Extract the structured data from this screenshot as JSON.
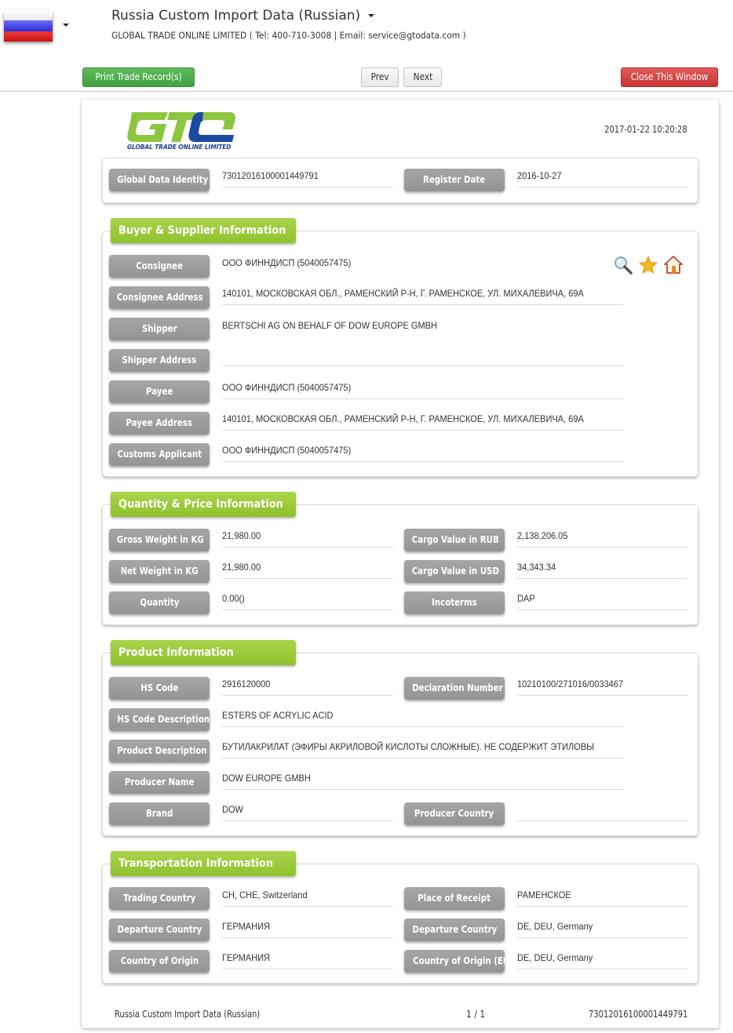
{
  "header": {
    "title": "Russia Custom Import Data (Russian)",
    "subtitle": "GLOBAL TRADE ONLINE LIMITED ( Tel: 400-710-3008 | Email: service@gtodata.com )",
    "flag_icon": "russia-flag-icon"
  },
  "toolbar": {
    "print_label": "Print Trade Record(s)",
    "prev_label": "Prev",
    "next_label": "Next",
    "close_label": "Close This Window"
  },
  "colors": {
    "accent_green": "#8ec22f",
    "print_button": "#4cae4c",
    "close_button": "#d43f3f",
    "label_gray": "#9a9a9a"
  },
  "record": {
    "logo_text": "GLOBAL TRADE ONLINE LIMITED",
    "timestamp": "2017-01-22 10:20:28",
    "identity": {
      "global_data_identity_label": "Global Data Identity",
      "global_data_identity": "73012016100001449791",
      "register_date_label": "Register Date",
      "register_date": "2016-10-27"
    },
    "buyer_supplier": {
      "title": "Buyer & Supplier Information",
      "rows": [
        {
          "label": "Consignee",
          "value": "ООО ФИННДИСП (5040057475)"
        },
        {
          "label": "Consignee Address",
          "value": "140101, МОСКОВСКАЯ ОБЛ., РАМЕНСКИЙ Р-Н, Г. РАМЕНСКОЕ, УЛ. МИХАЛЕВИЧА, 69А"
        },
        {
          "label": "Shipper",
          "value": "BERTSCHI AG ON BEHALF OF DOW EUROPE GMBH"
        },
        {
          "label": "Shipper Address",
          "value": ""
        },
        {
          "label": "Payee",
          "value": "ООО ФИННДИСП  (5040057475)"
        },
        {
          "label": "Payee Address",
          "value": "140101, МОСКОВСКАЯ ОБЛ., РАМЕНСКИЙ Р-Н, Г. РАМЕНСКОЕ, УЛ. МИХАЛЕВИЧА, 69А"
        },
        {
          "label": "Customs Applicant",
          "value": "ООО ФИННДИСП  (5040057475)"
        }
      ],
      "icons": [
        "search-icon",
        "star-icon",
        "home-icon"
      ]
    },
    "quantity_price": {
      "title": "Quantity & Price Information",
      "rows": [
        {
          "label": "Gross Weight in KG",
          "value": "21,980.00",
          "label2": "Cargo Value in RUB",
          "value2": "2,138,206.05"
        },
        {
          "label": "Net Weight in KG",
          "value": "21,980.00",
          "label2": "Cargo Value in USD",
          "value2": "34,343.34"
        },
        {
          "label": "Quantity",
          "value": "0.00()",
          "label2": "Incoterms",
          "value2": "DAP"
        }
      ]
    },
    "product": {
      "title": "Product Information",
      "hs_code_label": "HS Code",
      "hs_code": "2916120000",
      "declaration_number_label": "Declaration Number",
      "declaration_number": "10210100/271016/0033467",
      "hs_code_description_label": "HS Code Description",
      "hs_code_description": "ESTERS OF ACRYLIC ACID",
      "product_description_label": "Product Description",
      "product_description": "БУТИЛАКРИЛАТ (ЭФИРЫ АКРИЛОВОЙ КИСЛОТЫ СЛОЖНЫЕ). НЕ СОДЕРЖИТ ЭТИЛОВЫ",
      "producer_name_label": "Producer Name",
      "producer_name": "DOW EUROPE GMBH",
      "brand_label": "Brand",
      "brand": "DOW",
      "producer_country_label": "Producer Country",
      "producer_country": ""
    },
    "transportation": {
      "title": "Transportation Information",
      "rows": [
        {
          "label": "Trading Country",
          "value": "CH, CHE, Switzerland",
          "label2": "Place of Receipt",
          "value2": "РАМЕНСКОЕ"
        },
        {
          "label": "Departure Country",
          "value": "ГЕРМАНИЯ",
          "label2": "Departure Country",
          "value2": "DE, DEU, Germany"
        },
        {
          "label": "Country of Origin",
          "value": "ГЕРМАНИЯ",
          "label2": "Country of Origin (EN)",
          "value2": "DE, DEU, Germany"
        }
      ]
    },
    "footer": {
      "source": "Russia Custom Import Data (Russian)",
      "page": "1 / 1",
      "identity": "73012016100001449791"
    }
  }
}
